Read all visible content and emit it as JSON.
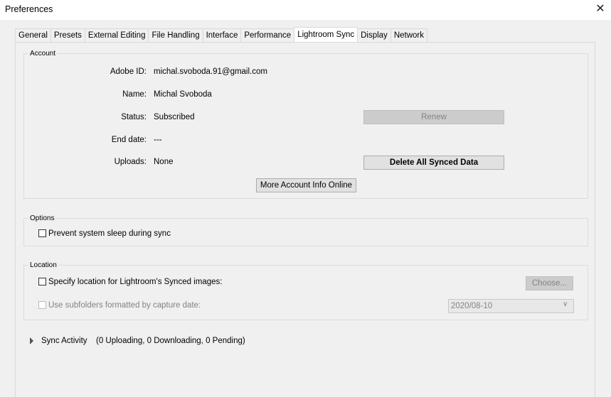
{
  "window": {
    "title": "Preferences"
  },
  "tabs": [
    "General",
    "Presets",
    "External Editing",
    "File Handling",
    "Interface",
    "Performance",
    "Lightroom Sync",
    "Display",
    "Network"
  ],
  "active_tab": "Lightroom Sync",
  "account": {
    "group_label": "Account",
    "adobe_id_label": "Adobe ID:",
    "adobe_id_value": "michal.svoboda.91@gmail.com",
    "name_label": "Name:",
    "name_value": "Michal Svoboda",
    "status_label": "Status:",
    "status_value": "Subscribed",
    "end_date_label": "End date:",
    "end_date_value": "---",
    "uploads_label": "Uploads:",
    "uploads_value": "None",
    "renew_button": "Renew",
    "delete_button": "Delete All Synced Data",
    "more_info_button": "More Account Info Online"
  },
  "options": {
    "group_label": "Options",
    "prevent_sleep_label": "Prevent system sleep during sync",
    "prevent_sleep_checked": false
  },
  "location": {
    "group_label": "Location",
    "specify_label": "Specify location for Lightroom's Synced images:",
    "specify_checked": false,
    "choose_button": "Choose...",
    "subfolders_label": "Use subfolders formatted by capture date:",
    "subfolders_checked": false,
    "date_format_value": "2020/08-10"
  },
  "sync_activity": {
    "label": "Sync Activity",
    "status": "(0 Uploading, 0 Downloading, 0 Pending)"
  }
}
